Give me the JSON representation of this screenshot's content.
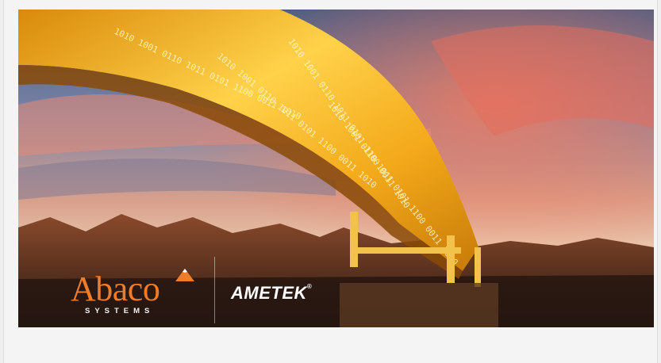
{
  "banner": {
    "brand_primary": {
      "name": "Abaco",
      "tagline": "SYSTEMS",
      "color": "#ee7d2b"
    },
    "brand_secondary": {
      "name": "AMETEK",
      "mark": "®"
    },
    "binary_text": "1010 1001 0110 1011 0101 1100 0011 1010",
    "scene": {
      "sky_top": "#3f5f8c",
      "sky_glow": "#f0846e",
      "pipeline_color": "#f2b01e",
      "mountains": "#7a3f28"
    }
  }
}
